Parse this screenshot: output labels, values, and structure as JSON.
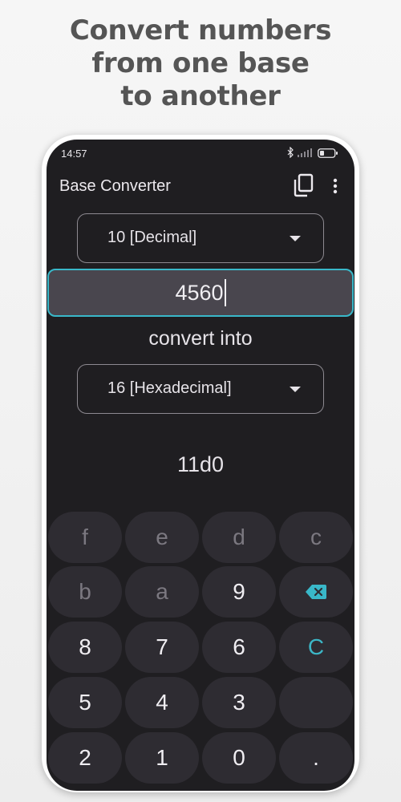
{
  "promo": {
    "line1": "Convert numbers",
    "line2": "from one base",
    "line3": "to another"
  },
  "status_bar": {
    "time": "14:57"
  },
  "app_bar": {
    "title": "Base Converter",
    "copy_icon": "copy-icon",
    "more_icon": "more-vert-icon"
  },
  "from_base": {
    "selected": "10 [Decimal]"
  },
  "input": {
    "value": "4560"
  },
  "convert_label": "convert into",
  "to_base": {
    "selected": "16 [Hexadecimal]"
  },
  "result": "11d0",
  "keypad": {
    "rows": [
      [
        {
          "label": "f",
          "state": "disabled"
        },
        {
          "label": "e",
          "state": "disabled"
        },
        {
          "label": "d",
          "state": "disabled"
        },
        {
          "label": "c",
          "state": "disabled"
        }
      ],
      [
        {
          "label": "b",
          "state": "disabled"
        },
        {
          "label": "a",
          "state": "disabled"
        },
        {
          "label": "9",
          "state": "enabled"
        },
        {
          "label": "",
          "icon": "backspace-icon",
          "state": "accent"
        }
      ],
      [
        {
          "label": "8",
          "state": "enabled"
        },
        {
          "label": "7",
          "state": "enabled"
        },
        {
          "label": "6",
          "state": "enabled"
        },
        {
          "label": "C",
          "state": "accent"
        }
      ],
      [
        {
          "label": "5",
          "state": "enabled"
        },
        {
          "label": "4",
          "state": "enabled"
        },
        {
          "label": "3",
          "state": "enabled"
        },
        {
          "label": "",
          "state": "empty"
        }
      ],
      [
        {
          "label": "2",
          "state": "enabled"
        },
        {
          "label": "1",
          "state": "enabled"
        },
        {
          "label": "0",
          "state": "enabled"
        },
        {
          "label": ".",
          "state": "enabled"
        }
      ]
    ]
  },
  "colors": {
    "accent": "#39b8c9",
    "background": "#1f1e21",
    "key": "#2e2c32",
    "input": "#49464e"
  }
}
